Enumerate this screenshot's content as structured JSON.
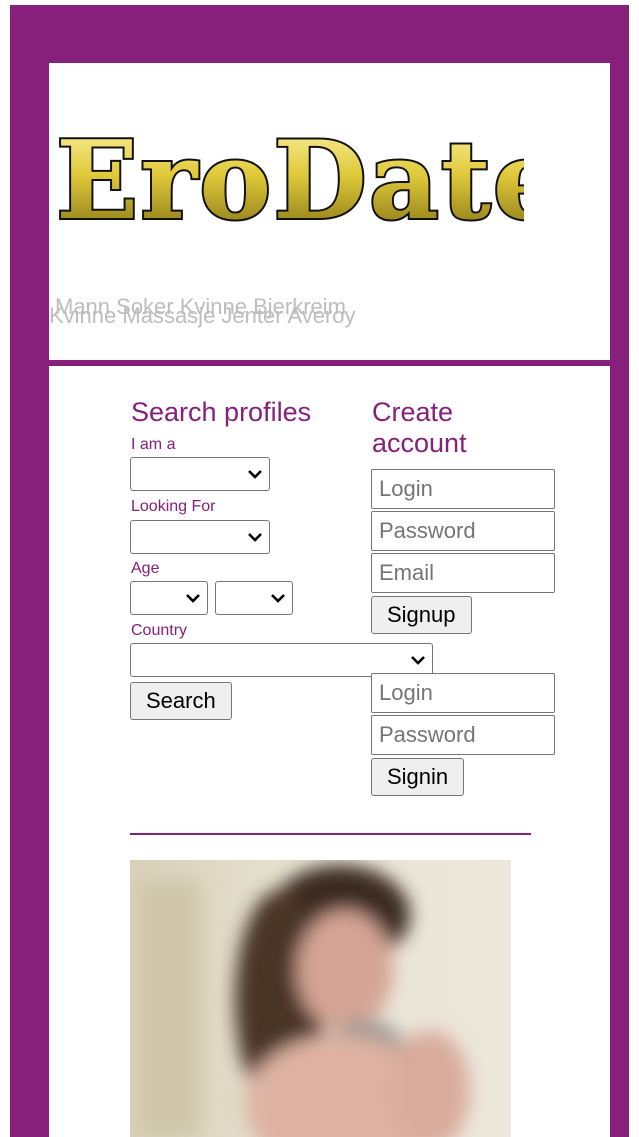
{
  "header": {
    "logo_text": "EroDate",
    "tagline_lines": [
      "Mann Soker Kvinne Bjerkreim",
      "Kvinne Massasje Jenter Averoy"
    ]
  },
  "search": {
    "title": "Search profiles",
    "iam_label": "I am a",
    "looking_for_label": "Looking For",
    "age_label": "Age",
    "country_label": "Country",
    "search_button": "Search"
  },
  "create_account": {
    "title_line1": "Create",
    "title_line2": "account",
    "login_placeholder": "Login",
    "password_placeholder": "Password",
    "email_placeholder": "Email",
    "signup_button": "Signup"
  },
  "signin": {
    "login_placeholder": "Login",
    "password_placeholder": "Password",
    "signin_button": "Signin"
  },
  "colors": {
    "brand_purple": "#86207a",
    "logo_gold": "#d9c63a"
  },
  "icons": [
    "chevron-down-icon"
  ]
}
